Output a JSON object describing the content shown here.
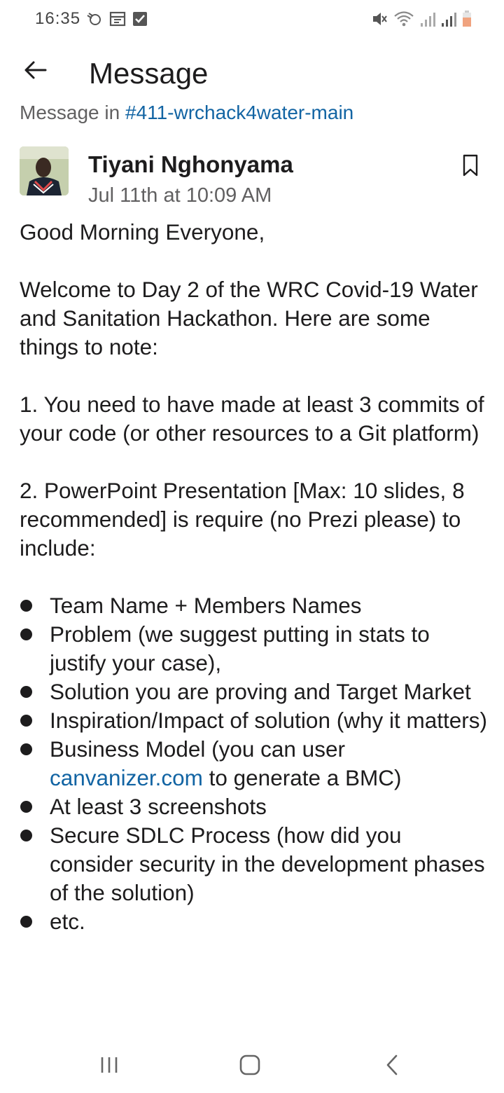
{
  "status_bar": {
    "time": "16:35",
    "left_icons": [
      "sync-icon",
      "calendar-icon",
      "checkbox-icon"
    ],
    "right_icons": [
      "mute-icon",
      "wifi-icon",
      "signal-icon",
      "signal-icon-2",
      "battery-icon"
    ]
  },
  "header": {
    "back_icon": "arrow-left-icon",
    "title": "Message"
  },
  "context": {
    "prefix": "Message in ",
    "channel": "#411-wrchack4water-main"
  },
  "message": {
    "author": "Tiyani Nghonyama",
    "timestamp": "Jul 11th at 10:09 AM",
    "greeting": "Good Morning Everyone,",
    "intro": "Welcome to Day 2 of the WRC Covid-19 Water and Sanitation Hackathon. Here are some things to note:",
    "point1": "1. You need to have made at least 3 commits of your code (or other resources to a Git platform)",
    "point2": "2. PowerPoint Presentation [Max: 10 slides, 8 recommended] is require (no Prezi please) to include:",
    "bullets": [
      "Team Name + Members Names",
      "Problem (we suggest putting in stats to justify your case),",
      "Solution you are proving and Target Market",
      "Inspiration/Impact of solution (why it matters)",
      "Business Model (you can user ",
      "At least 3 screenshots",
      "Secure SDLC Process (how did you consider security in the development phases of the solution)",
      "etc."
    ],
    "bullet5_link": "canvanizer.com",
    "bullet5_suffix": " to generate a BMC)"
  },
  "nav_bar": {
    "recents": "recents-icon",
    "home": "home-icon",
    "back": "back-icon"
  },
  "colors": {
    "link": "#1264a3",
    "text": "#1d1c1d",
    "secondary": "#616061",
    "battery": "#f0a37f"
  }
}
